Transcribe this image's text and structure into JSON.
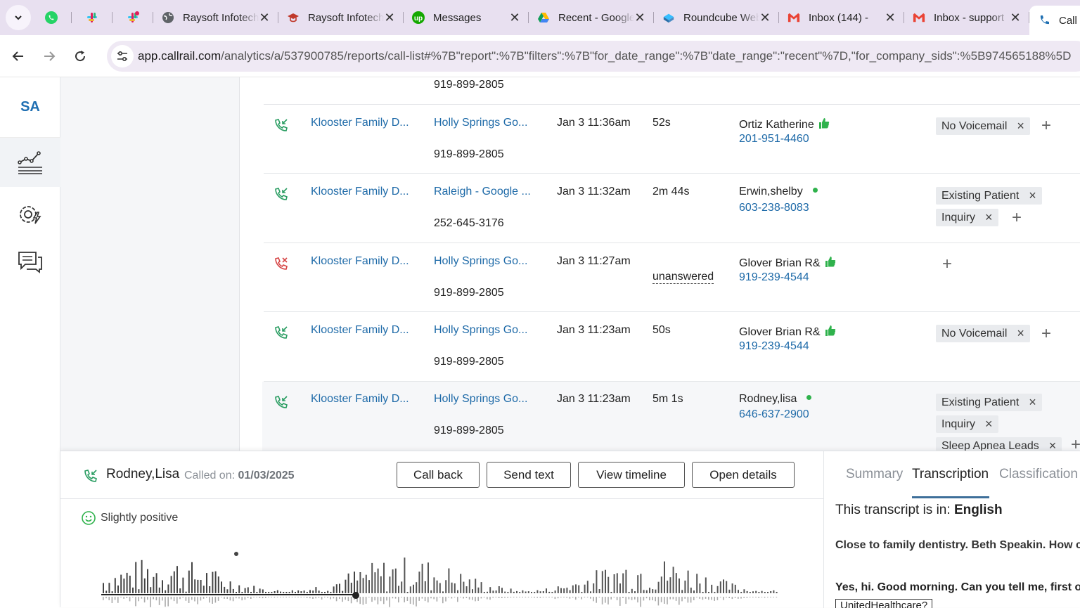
{
  "browser": {
    "tabs": [
      {
        "title": "Raysoft Infotech",
        "icon": "globe-icon"
      },
      {
        "title": "Raysoft Infotech",
        "icon": "graduation-cap-icon"
      },
      {
        "title": "Messages",
        "icon": "upwork-icon"
      },
      {
        "title": "Recent - Google Drive",
        "icon": "google-drive-icon"
      },
      {
        "title": "Roundcube Webmail",
        "icon": "roundcube-icon"
      },
      {
        "title": "Inbox (144) -",
        "icon": "gmail-icon"
      },
      {
        "title": "Inbox - support",
        "icon": "gmail-icon"
      },
      {
        "title": "Call",
        "icon": "callrail-icon"
      }
    ],
    "url_domain": "app.callrail.com",
    "url_path": "/analytics/a/537900785/reports/call-list#%7B\"report\":%7B\"filters\":%7B\"for_date_range\":%7B\"date_range\":\"recent\"%7D,\"for_company_sids\":%5B974565188%5D"
  },
  "sidenav": {
    "initials": "SA"
  },
  "calls_top_partial": {
    "tracking_number": "919-899-2805"
  },
  "calls": [
    {
      "status": "answered",
      "company": "Klooster Family D...",
      "source": "Holly Springs Go...",
      "tracking": "919-899-2805",
      "datetime": "Jan 3 11:36am",
      "duration": "52s",
      "caller": "Ortiz Katherine",
      "caller_mark": "thumbs-up",
      "phone": "201-951-4460",
      "tags": [
        "No Voicemail"
      ]
    },
    {
      "status": "answered",
      "company": "Klooster Family D...",
      "source": "Raleigh - Google ...",
      "tracking": "252-645-3176",
      "datetime": "Jan 3 11:32am",
      "duration": "2m 44s",
      "caller": "Erwin,shelby",
      "caller_mark": "green-dot",
      "phone": "603-238-8083",
      "tags": [
        "Existing Patient",
        "Inquiry"
      ]
    },
    {
      "status": "missed",
      "company": "Klooster Family D...",
      "source": "Holly Springs Go...",
      "tracking": "919-899-2805",
      "datetime": "Jan 3 11:27am",
      "duration": "unanswered",
      "caller": "Glover Brian R&",
      "caller_mark": "thumbs-up",
      "phone": "919-239-4544",
      "tags": []
    },
    {
      "status": "answered",
      "company": "Klooster Family D...",
      "source": "Holly Springs Go...",
      "tracking": "919-899-2805",
      "datetime": "Jan 3 11:23am",
      "duration": "50s",
      "caller": "Glover Brian R&",
      "caller_mark": "thumbs-up",
      "phone": "919-239-4544",
      "tags": [
        "No Voicemail"
      ]
    },
    {
      "status": "answered",
      "company": "Klooster Family D...",
      "source": "Holly Springs Go...",
      "tracking": "919-899-2805",
      "datetime": "Jan 3 11:23am",
      "duration": "5m 1s",
      "caller": "Rodney,lisa",
      "caller_mark": "green-dot",
      "phone": "646-637-2900",
      "tags": [
        "Existing Patient",
        "Inquiry",
        "Sleep Apnea Leads"
      ]
    }
  ],
  "detail": {
    "caller_name": "Rodney,Lisa",
    "called_on_label": "Called on:",
    "called_on_date": "01/03/2025",
    "buttons": {
      "call_back": "Call back",
      "send_text": "Send text",
      "view_timeline": "View timeline",
      "open_details": "Open details"
    },
    "sentiment": "Slightly positive",
    "tabs": {
      "summary": "Summary",
      "transcription": "Transcription",
      "classification": "Classification"
    },
    "transcript_lang_label": "This transcript is in:",
    "transcript_lang": "English",
    "transcript_lines": [
      "Close to family dentistry. Beth Speakin. How can I help you?",
      "Yes, hi. Good morning. Can you tell me, first of all,",
      "UnitedHealthcare?"
    ]
  },
  "colors": {
    "link": "#1e6aa8",
    "answered_icon": "#2a9d62",
    "missed_icon": "#d64545",
    "positive": "#2fb24c",
    "brand": "#1f6fb2"
  }
}
